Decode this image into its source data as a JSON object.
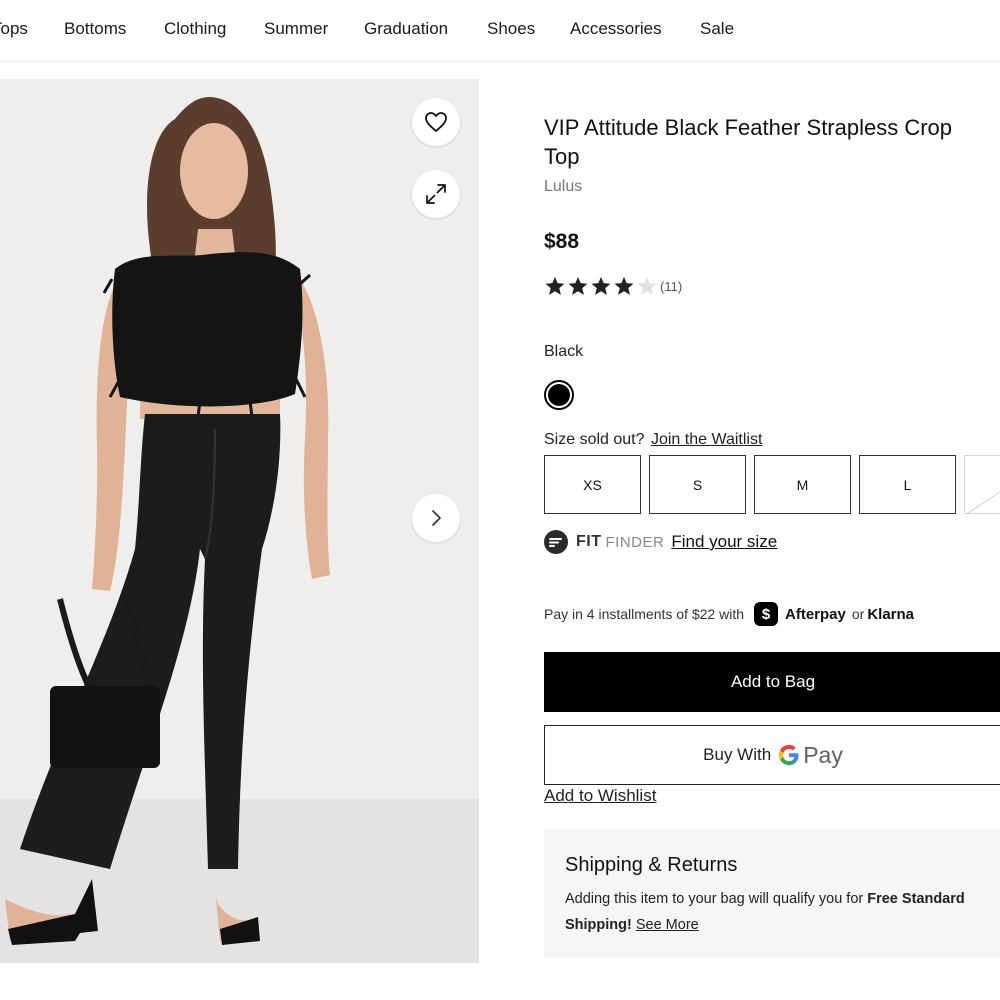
{
  "nav": {
    "items": [
      "Tops",
      "Bottoms",
      "Clothing",
      "Summer",
      "Graduation",
      "Shoes",
      "Accessories",
      "Sale"
    ]
  },
  "product": {
    "title": "VIP Attitude Black Feather Strapless Crop Top",
    "brand": "Lulus",
    "price": "$88",
    "rating": {
      "value": 4,
      "max": 5,
      "count": "(11)"
    },
    "color": {
      "name": "Black",
      "hex": "#000000"
    },
    "size_soldout_text": "Size sold out?",
    "waitlist_link": "Join the Waitlist",
    "sizes": [
      {
        "label": "XS",
        "available": true
      },
      {
        "label": "S",
        "available": true
      },
      {
        "label": "M",
        "available": true
      },
      {
        "label": "L",
        "available": true
      },
      {
        "label": "",
        "available": false
      }
    ]
  },
  "fit_finder": {
    "fit": "FIT",
    "finder": "FINDER",
    "link": "Find your size"
  },
  "installments": {
    "text": "Pay in 4 installments of $22 with",
    "afterpay_label": "Afterpay",
    "afterpay_badge": "$",
    "or": "or",
    "klarna_label": "Klarna"
  },
  "actions": {
    "add_to_bag": "Add to Bag",
    "buy_with": "Buy With",
    "gpay_word": "Pay",
    "add_to_wishlist": "Add to Wishlist"
  },
  "shipping": {
    "title": "Shipping & Returns",
    "body_start": "Adding this item to your bag will qualify you for ",
    "body_bold": "Free Standard Shipping!",
    "see_more": "See More"
  },
  "icons": {
    "wishlist": "heart-icon",
    "expand": "expand-icon",
    "next": "chevron-right-icon",
    "fit_finder": "fit-finder-logo-icon",
    "afterpay": "afterpay-badge-icon",
    "google": "google-g-icon"
  },
  "colors": {
    "primary_button": "#000000",
    "text": "#1a1a1a",
    "muted": "#777777",
    "star_filled": "#222222",
    "star_empty": "#e2e2e2",
    "shipping_bg": "#f6f6f6"
  }
}
